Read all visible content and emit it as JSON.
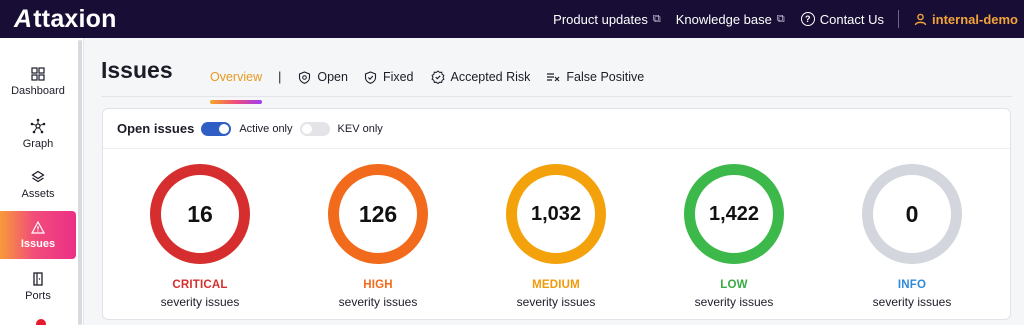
{
  "brand": {
    "name": "ttaxion",
    "initial": "A"
  },
  "topbar": {
    "links": [
      {
        "label": "Product updates",
        "ext": "⧉"
      },
      {
        "label": "Knowledge base",
        "ext": "⧉"
      },
      {
        "label": "Contact Us"
      }
    ],
    "user": "internal-demo"
  },
  "sidebar": {
    "items": [
      {
        "label": "Dashboard",
        "icon": "dashboard-icon"
      },
      {
        "label": "Graph",
        "icon": "graph-icon"
      },
      {
        "label": "Assets",
        "icon": "assets-icon"
      },
      {
        "label": "Issues",
        "icon": "warning-icon",
        "active": true
      },
      {
        "label": "Ports",
        "icon": "door-icon"
      }
    ]
  },
  "page": {
    "title": "Issues",
    "tabs": [
      {
        "label": "Overview",
        "active": true
      },
      {
        "label": "Open"
      },
      {
        "label": "Fixed"
      },
      {
        "label": "Accepted Risk"
      },
      {
        "label": "False Positive"
      }
    ],
    "tab_separator": "|"
  },
  "card": {
    "title": "Open issues",
    "toggles": [
      {
        "label": "Active only",
        "on": true
      },
      {
        "label": "KEV only",
        "on": false
      }
    ],
    "severities": [
      {
        "count": "16",
        "level": "CRITICAL",
        "sub": "severity issues",
        "color": "#d62e2e",
        "text_color": "#d62e2e"
      },
      {
        "count": "126",
        "level": "HIGH",
        "sub": "severity issues",
        "color": "#f26a1b",
        "text_color": "#f26a1b"
      },
      {
        "count": "1,032",
        "level": "MEDIUM",
        "sub": "severity issues",
        "color": "#f4a20c",
        "text_color": "#f09a0a"
      },
      {
        "count": "1,422",
        "level": "LOW",
        "sub": "severity issues",
        "color": "#3db84a",
        "text_color": "#3aaa45"
      },
      {
        "count": "0",
        "level": "INFO",
        "sub": "severity issues",
        "color": "#d3d6dc",
        "text_color": "#2f8ad9"
      }
    ]
  }
}
